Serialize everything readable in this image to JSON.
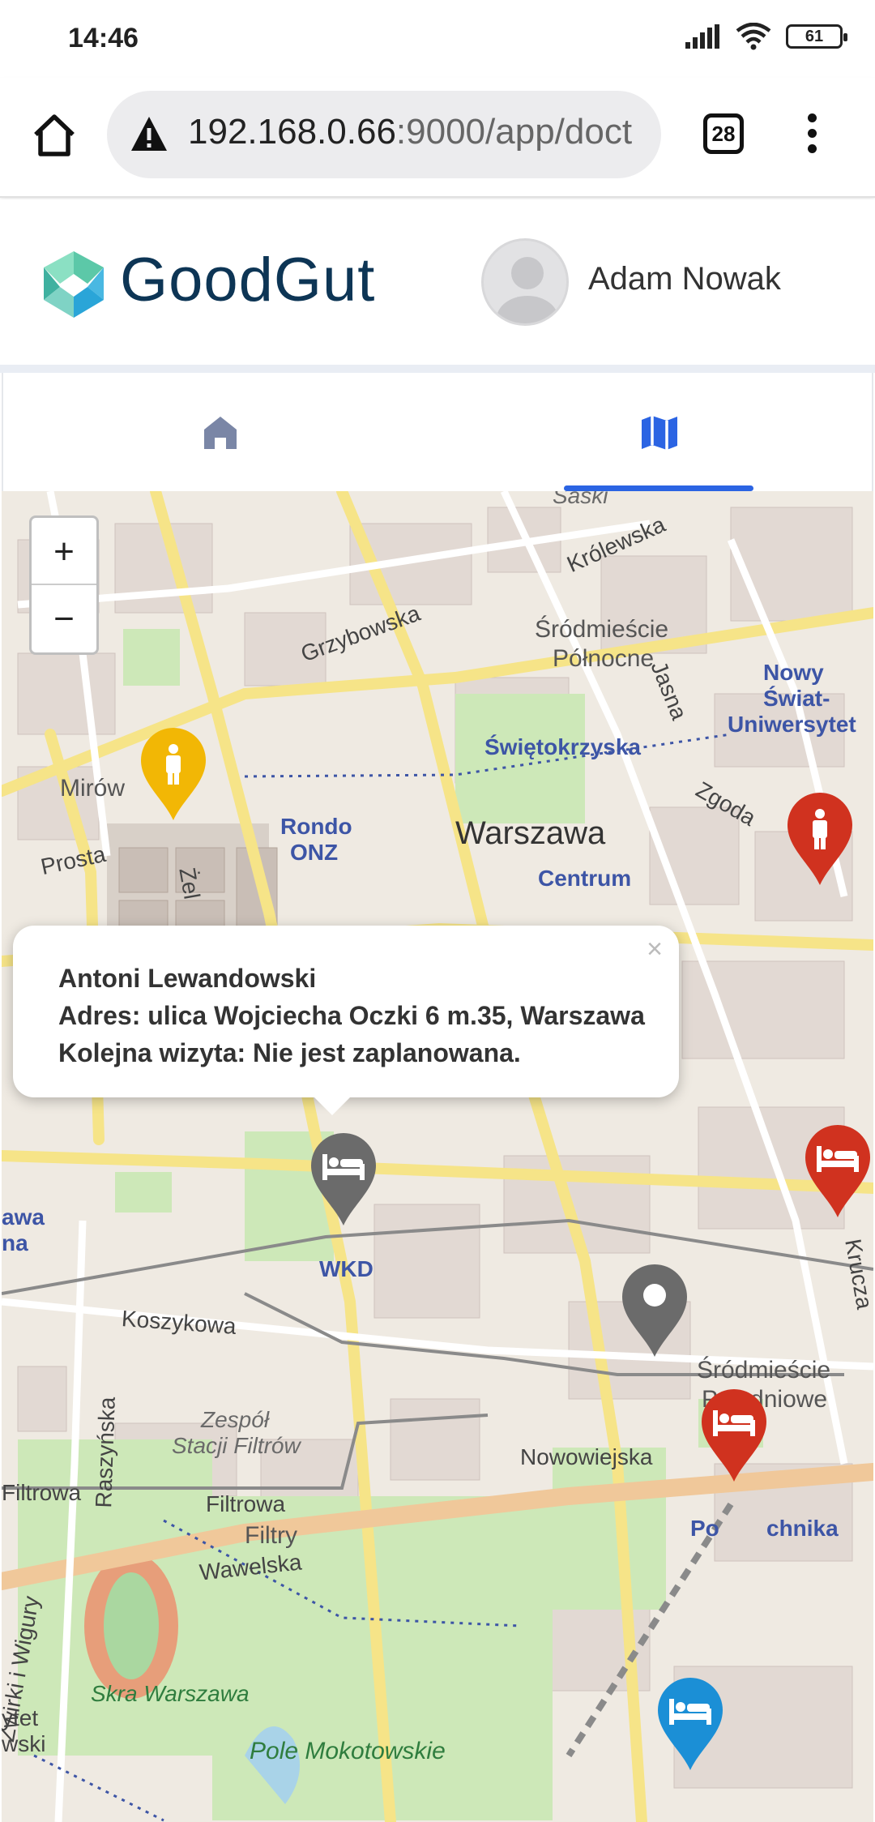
{
  "status_bar": {
    "time": "14:46",
    "battery": "61"
  },
  "browser": {
    "url_host": "192.168.0.66",
    "url_rest": ":9000/app/doct",
    "tab_count": "28"
  },
  "app": {
    "brand": "GoodGut",
    "user_name": "Adam Nowak"
  },
  "tabs": [
    {
      "name": "home",
      "icon": "home-icon",
      "active": false
    },
    {
      "name": "map",
      "icon": "map-icon",
      "active": true
    }
  ],
  "map": {
    "zoom_in": "+",
    "zoom_out": "−",
    "labels": {
      "saski": "Saski",
      "krolewska": "Królewska",
      "grzybowska": "Grzybowska",
      "srodmiescie_polnocne_1": "Śródmieście",
      "srodmiescie_polnocne_2": "Północne",
      "nowy_1": "Nowy",
      "nowy_2": "Świat-",
      "nowy_3": "Uniwersytet",
      "swietokrzyska": "Świętokrzyska",
      "jasna": "Jasna",
      "zgoda": "Zgoda",
      "mirow": "Mirów",
      "rondo_1": "Rondo",
      "rondo_2": "ONZ",
      "warszawa": "Warszawa",
      "centrum": "Centrum",
      "prosta": "Prosta",
      "zel": "Żel",
      "wkd": "WKD",
      "awa": "awa",
      "na": "na",
      "koszykowa": "Koszykowa",
      "krucza": "Krucza",
      "zespol_1": "Zespół",
      "zespol_2": "Stacji Filtrów",
      "raszynska": "Raszyńska",
      "srodmiescie_pd_1": "Śródmieście",
      "srodmiescie_pd_2": "Południowe",
      "nowowiejska": "Nowowiejska",
      "filtrowa_left": "Filtrowa",
      "filtrowa": "Filtrowa",
      "filtry": "Filtry",
      "politechnika_a": "Po",
      "politechnika_b": "chnika",
      "wawelska": "Wawelska",
      "skra": "Skra Warszawa",
      "zwirki": "Żwirki i Wigury",
      "pole": "Pole Mokotowskie",
      "ytet": "ytet",
      "wski": "wski"
    },
    "popup": {
      "line1": "Antoni Lewandowski",
      "line2": "Adres: ulica Wojciecha Oczki 6 m.35, Warszawa",
      "line3": "Kolejna wizyta: Nie jest zaplanowana.",
      "close": "×"
    },
    "markers": [
      {
        "kind": "person",
        "color": "#f2b705"
      },
      {
        "kind": "person",
        "color": "#d0321f"
      },
      {
        "kind": "bed",
        "color": "#d0321f"
      },
      {
        "kind": "bed",
        "color": "#6b6b6b"
      },
      {
        "kind": "location",
        "color": "#6b6b6b"
      },
      {
        "kind": "bed",
        "color": "#d0321f"
      },
      {
        "kind": "bed",
        "color": "#1b8fd6"
      }
    ]
  },
  "colors": {
    "brand": "#0d3555",
    "accent": "#2b64e3",
    "tab_inactive": "#7a86a6"
  }
}
